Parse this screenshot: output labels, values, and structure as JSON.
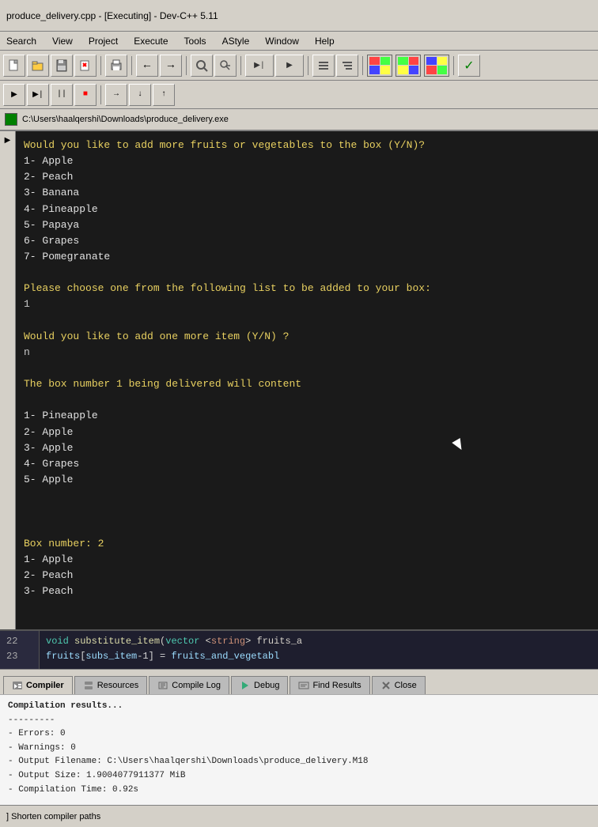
{
  "window": {
    "title": "produce_delivery.cpp - [Executing] - Dev-C++ 5.11"
  },
  "menu": {
    "items": [
      "Search",
      "View",
      "Project",
      "Execute",
      "Tools",
      "AStyle",
      "Window",
      "Help"
    ]
  },
  "address": {
    "path": "C:\\Users\\haalqershi\\Downloads\\produce_delivery.exe"
  },
  "terminal": {
    "lines": [
      "Would you like to add more fruits or vegetables to the box (Y/N)?",
      "1- Apple",
      "2- Peach",
      "3- Banana",
      "4- Pineapple",
      "5- Papaya",
      "6- Grapes",
      "7- Pomegranate",
      "",
      "Please choose one from the following list to be added to your box:",
      "1",
      "",
      "Would you like to add one more item (Y/N) ?",
      "n",
      "",
      "The box number 1 being delivered will content",
      "",
      "1- Pineapple",
      "2- Apple",
      "3- Apple",
      "4- Grapes",
      "5- Apple",
      "",
      "",
      "",
      "Box number: 2",
      "1- Apple",
      "2- Peach",
      "3- Peach"
    ]
  },
  "code": {
    "line22": "22",
    "line23": "23",
    "code_line1": "void substitute_item(vector <string> fruits_a",
    "code_line2": "    fruits[subs_item-1] = fruits_and_vegetabl"
  },
  "tabs": {
    "compiler_label": "Compiler",
    "resources_label": "Resources",
    "compile_log_label": "Compile Log",
    "debug_label": "Debug",
    "find_results_label": "Find Results",
    "close_label": "Close"
  },
  "compiler_output": {
    "lines": [
      "Compilation results...",
      "---------",
      "- Errors: 0",
      "- Warnings: 0",
      "- Output Filename: C:\\Users\\haalqershi\\Downloads\\produce_delivery.M18",
      "- Output Size: 1.9004077911377 MiB",
      "- Compilation Time: 0.92s"
    ]
  },
  "status_bar": {
    "shorten_label": "] Shorten compiler paths"
  }
}
